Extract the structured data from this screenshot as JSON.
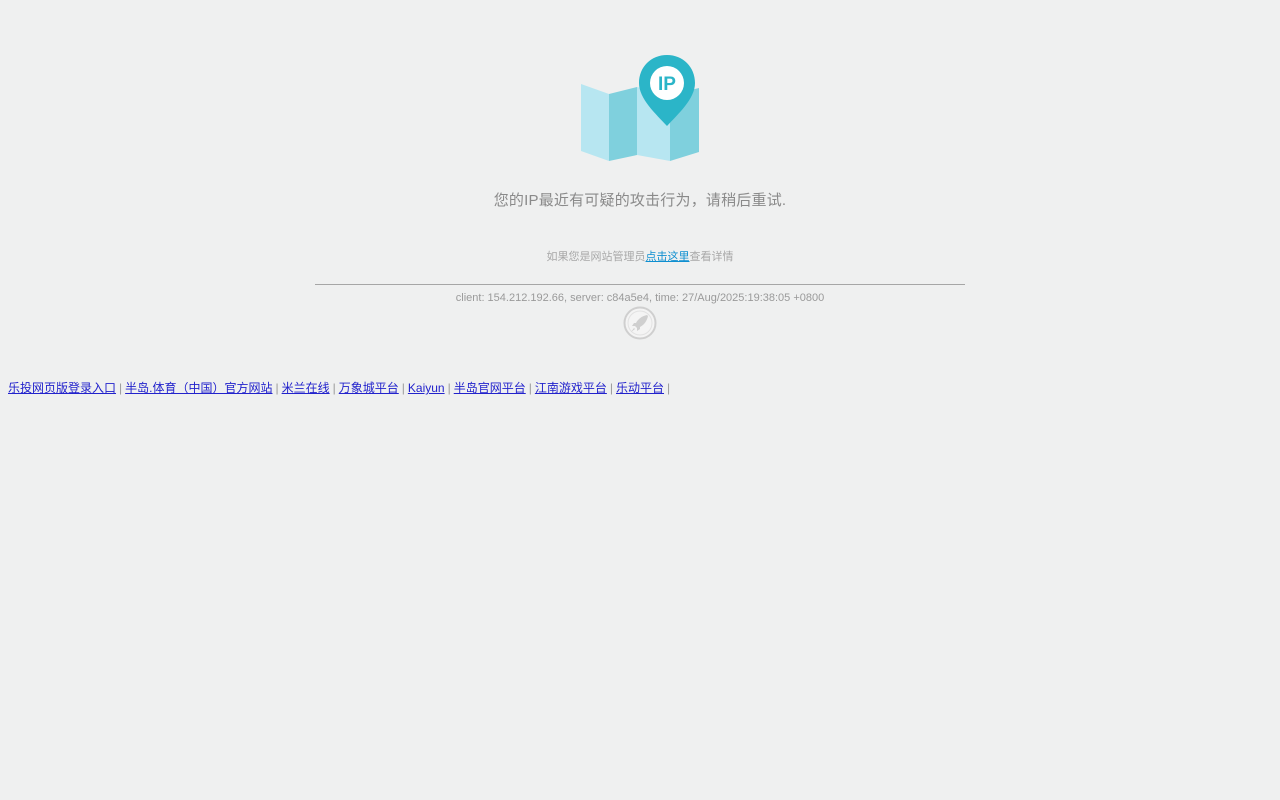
{
  "main": {
    "message": "您的IP最近有可疑的攻击行为，请稍后重试.",
    "admin_prefix": "如果您是网站管理员",
    "admin_link": "点击这里",
    "admin_suffix": "查看详情",
    "client_info": "client: 154.212.192.66, server: c84a5e4, time: 27/Aug/2025:19:38:05 +0800",
    "icon_text": "IP",
    "icon": "map-pin-ip-icon",
    "logo_icon": "rocket-badge-icon"
  },
  "colors": {
    "background": "#eff0f0",
    "pin": "#2bb5c8",
    "map_light": "#b7e6f1",
    "map_dark": "#7fd0dd",
    "link": "#0f8fd0"
  },
  "footer": {
    "links": [
      {
        "label": "乐投网页版登录入口"
      },
      {
        "label": "半岛.体育（中国）官方网站"
      },
      {
        "label": "米兰在线"
      },
      {
        "label": "万象城平台"
      },
      {
        "label": "Kaiyun"
      },
      {
        "label": "半岛官网平台"
      },
      {
        "label": "江南游戏平台"
      },
      {
        "label": "乐动平台"
      }
    ],
    "separator": "|"
  }
}
